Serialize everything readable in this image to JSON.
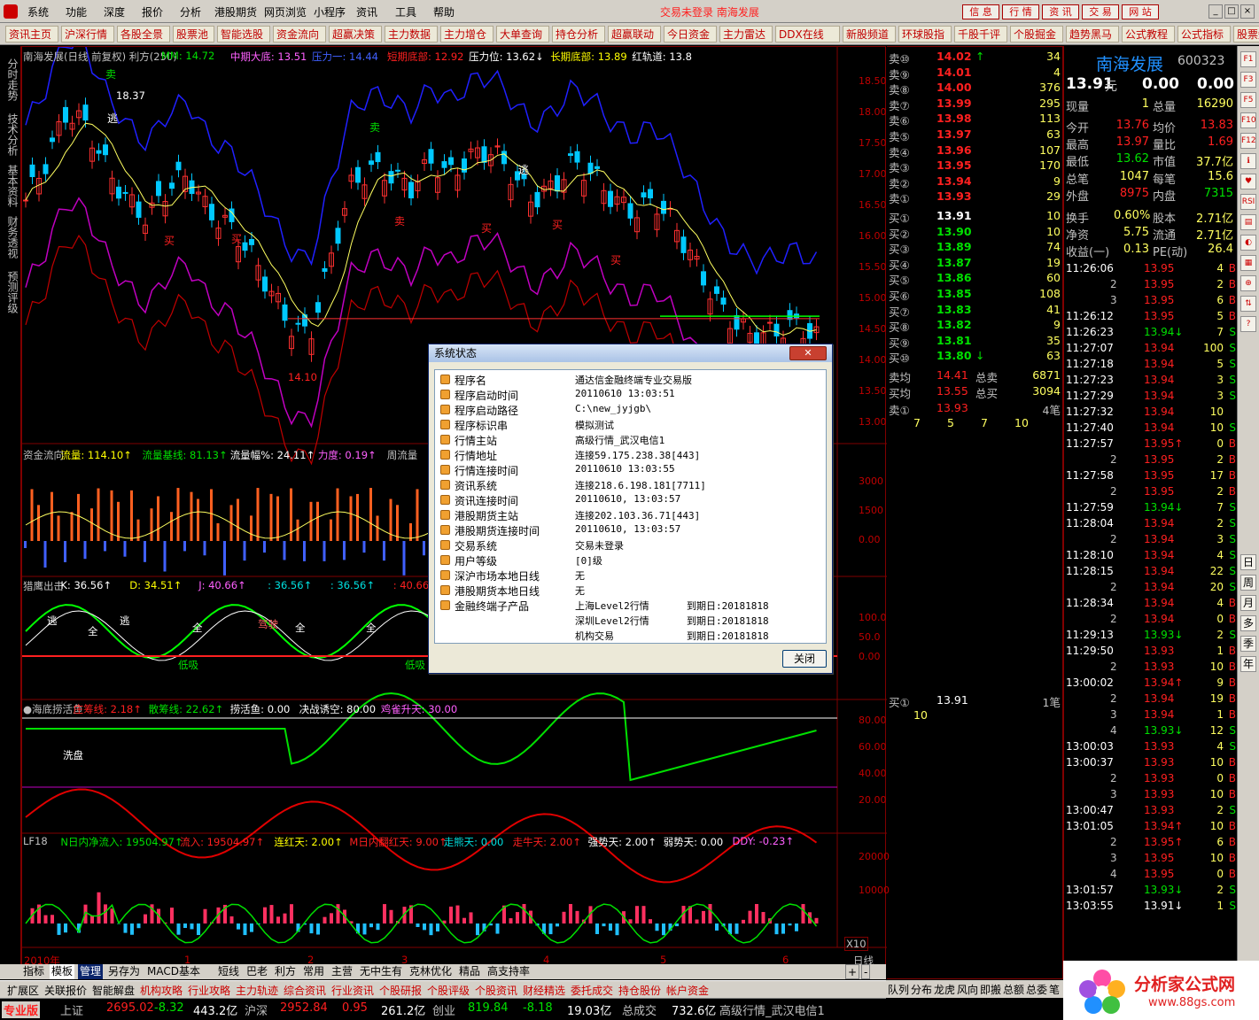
{
  "menu": [
    "系统",
    "功能",
    "深度",
    "报价",
    "分析",
    "港股期货",
    "网页浏览",
    "小程序",
    "资讯",
    "工具",
    "帮助"
  ],
  "trade_message": "交易未登录  南海发展",
  "right_buttons": [
    "信 息",
    "行 情",
    "资 讯",
    "交 易",
    "网 站"
  ],
  "toolbar": [
    "资讯主页",
    "沪深行情",
    "各股全景",
    "股票池",
    "智能选股",
    "资金流向",
    "超赢决策",
    "主力数据",
    "主力增仓",
    "大单查询",
    "持仓分析",
    "超赢联动",
    "今日资金",
    "主力雷达",
    "DDX在线",
    "新股频道",
    "环球股指",
    "千股千评",
    "个股掘金",
    "趋势黑马",
    "公式教程",
    "公式指标",
    "股票知识"
  ],
  "left_tabs": [
    "分时走势",
    "技术分析",
    "基本资料",
    "财务透视",
    "预测评级"
  ],
  "chart": {
    "title_row": [
      {
        "t": "南海发展(日线 前复权) 利方(250)",
        "c": "#c0c0c0"
      },
      {
        "t": "MM: 14.72",
        "c": "#00e000"
      },
      {
        "t": "中期大底: 13.51",
        "c": "#ff60ff"
      },
      {
        "t": "压力一: 14.44",
        "c": "#4060ff"
      },
      {
        "t": "短期底部: 12.92",
        "c": "#ff2020"
      },
      {
        "t": "压力位: 13.62↓",
        "c": "#ffffff"
      },
      {
        "t": "长期底部: 13.89",
        "c": "#ffff00"
      },
      {
        "t": "红轨道: 13.8",
        "c": "#ffffff"
      }
    ],
    "price_axis": [
      "18.50",
      "18.00",
      "17.50",
      "17.00",
      "16.50",
      "16.00",
      "15.50",
      "15.00",
      "14.50",
      "14.00",
      "13.50",
      "13.00"
    ],
    "label_peak": "18.37",
    "label_low": "14.10",
    "signals": [
      "卖",
      "卖",
      "逃",
      "买",
      "买",
      "卖",
      "买",
      "买",
      "买",
      "逃"
    ],
    "fund_row": [
      {
        "t": "资金流向",
        "c": "#c0c0c0"
      },
      {
        "t": "流量: 114.10↑",
        "c": "#ffff00"
      },
      {
        "t": "流量基线: 81.13↑",
        "c": "#00e000"
      },
      {
        "t": "流量幅%: 24.11↑",
        "c": "#ffffff"
      },
      {
        "t": "力度: 0.19↑",
        "c": "#ff60ff"
      },
      {
        "t": "周流量",
        "c": "#c0c0c0"
      }
    ],
    "fund_axis": [
      "3000",
      "1500",
      "0.00"
    ],
    "kdj_row": [
      {
        "t": "猎鹰出击",
        "c": "#c0c0c0"
      },
      {
        "t": "K: 36.56↑",
        "c": "#ffffff"
      },
      {
        "t": "D: 34.51↑",
        "c": "#ffff00"
      },
      {
        "t": "J: 40.66↑",
        "c": "#ff60ff"
      },
      {
        "t": ": 36.56↑",
        "c": "#00e0e0"
      },
      {
        "t": ": 36.56↑",
        "c": "#00e0e0"
      },
      {
        "t": ": 40.66↑",
        "c": "#ff2020"
      },
      {
        "t": ": 40.66↑",
        "c": "#00e000"
      }
    ],
    "kdj_axis": [
      "100.0",
      "50.0",
      "0.00"
    ],
    "kdj_labels": [
      "逃",
      "逃",
      "全",
      "低吸",
      "全",
      "驾驶",
      "全",
      "全",
      "低吸"
    ],
    "fish_row": [
      {
        "t": "●海底捞活鱼",
        "c": "#c0c0c0"
      },
      {
        "t": "庄筹线: 2.18↑",
        "c": "#ff2020"
      },
      {
        "t": "散筹线: 22.62↑",
        "c": "#00e000"
      },
      {
        "t": "捞活鱼: 0.00",
        "c": "#ffffff"
      },
      {
        "t": "决战诱空: 80.00",
        "c": "#ffffff"
      },
      {
        "t": "鸡雀升天: 30.00",
        "c": "#ff60ff"
      }
    ],
    "fish_axis": [
      "80.00",
      "60.00",
      "40.00",
      "20.00"
    ],
    "fish_label": "洗盘",
    "lf_row": [
      {
        "t": "LF18",
        "c": "#c0c0c0"
      },
      {
        "t": "N日内净流入: 19504.97↑",
        "c": "#00e000"
      },
      {
        "t": "流入: 19504.97↑",
        "c": "#ff2020"
      },
      {
        "t": "连红天: 2.00↑",
        "c": "#ffff00"
      },
      {
        "t": "M日内翻红天: 9.00↑",
        "c": "#ff2020"
      },
      {
        "t": "走熊天: 0.00",
        "c": "#00e0e0"
      },
      {
        "t": "走牛天: 2.00↑",
        "c": "#ff2020"
      },
      {
        "t": "强势天: 2.00↑",
        "c": "#ffffff"
      },
      {
        "t": "弱势天: 0.00",
        "c": "#ffffff"
      },
      {
        "t": "DDY: -0.23↑",
        "c": "#ff60ff"
      }
    ],
    "lf_axis": [
      "20000",
      "10000"
    ],
    "x10": "X10",
    "time_axis": [
      "2010年",
      "1",
      "2",
      "3",
      "4",
      "5",
      "6"
    ],
    "period": "日线"
  },
  "bottom_tabs": [
    "指标",
    "模板",
    "管理",
    "另存为",
    "MACD基本",
    "短线",
    "巴老",
    "利方",
    "常用",
    "主营",
    "无中生有",
    "克林优化",
    "精品",
    "高支持率"
  ],
  "bottom_links": [
    "扩展区",
    "关联报价",
    "智能解盘",
    "机构攻略",
    "行业攻略",
    "主力轨迹",
    "综合资讯",
    "行业资讯",
    "个股研报",
    "个股评级",
    "个股资讯",
    "财经精选",
    "委托成交",
    "持仓股份",
    "帐户资金"
  ],
  "status": [
    {
      "t": "专业版",
      "c": "#ff2020"
    },
    {
      "t": "上证",
      "c": "#c0c0c0"
    },
    {
      "t": "2695.02",
      "c": "#ff2020"
    },
    {
      "t": "-8.32",
      "c": "#00e000"
    },
    {
      "t": "443.2亿",
      "c": "#ffffff"
    },
    {
      "t": "沪深",
      "c": "#c0c0c0"
    },
    {
      "t": "2952.84",
      "c": "#ff2020"
    },
    {
      "t": "0.95",
      "c": "#ff2020"
    },
    {
      "t": "261.2亿",
      "c": "#ffffff"
    },
    {
      "t": "创业",
      "c": "#c0c0c0"
    },
    {
      "t": "819.84",
      "c": "#00e000"
    },
    {
      "t": "-8.18",
      "c": "#00e000"
    },
    {
      "t": "19.03亿",
      "c": "#ffffff"
    },
    {
      "t": "总成交",
      "c": "#c0c0c0"
    },
    {
      "t": "732.6亿",
      "c": "#ffffff"
    },
    {
      "t": "高级行情_武汉电信1",
      "c": "#c0c0c0"
    }
  ],
  "orderbook": {
    "sells": [
      {
        "l": "卖⑩",
        "p": "14.02",
        "v": "34",
        "a": "↑"
      },
      {
        "l": "卖⑨",
        "p": "14.01",
        "v": "4",
        "a": ""
      },
      {
        "l": "卖⑧",
        "p": "14.00",
        "v": "376",
        "a": ""
      },
      {
        "l": "卖⑦",
        "p": "13.99",
        "v": "295",
        "a": ""
      },
      {
        "l": "卖⑥",
        "p": "13.98",
        "v": "113",
        "a": ""
      },
      {
        "l": "卖⑤",
        "p": "13.97",
        "v": "63",
        "a": ""
      },
      {
        "l": "卖④",
        "p": "13.96",
        "v": "107",
        "a": ""
      },
      {
        "l": "卖③",
        "p": "13.95",
        "v": "170",
        "a": ""
      },
      {
        "l": "卖②",
        "p": "13.94",
        "v": "9",
        "a": ""
      },
      {
        "l": "卖①",
        "p": "13.93",
        "v": "29",
        "a": ""
      }
    ],
    "buys": [
      {
        "l": "买①",
        "p": "13.91",
        "v": "10",
        "a": ""
      },
      {
        "l": "买②",
        "p": "13.90",
        "v": "10",
        "a": ""
      },
      {
        "l": "买③",
        "p": "13.89",
        "v": "74",
        "a": ""
      },
      {
        "l": "买④",
        "p": "13.87",
        "v": "19",
        "a": ""
      },
      {
        "l": "买⑤",
        "p": "13.86",
        "v": "60",
        "a": ""
      },
      {
        "l": "买⑥",
        "p": "13.85",
        "v": "108",
        "a": ""
      },
      {
        "l": "买⑦",
        "p": "13.83",
        "v": "41",
        "a": ""
      },
      {
        "l": "买⑧",
        "p": "13.82",
        "v": "9",
        "a": ""
      },
      {
        "l": "买⑨",
        "p": "13.81",
        "v": "35",
        "a": ""
      },
      {
        "l": "买⑩",
        "p": "13.80",
        "v": "63",
        "a": "↓"
      }
    ],
    "avg_sell": {
      "l": "卖均",
      "p": "14.41",
      "k": "总卖",
      "v": "6871"
    },
    "avg_buy": {
      "l": "买均",
      "p": "13.55",
      "k": "总买",
      "v": "3094"
    },
    "sell1_detail": {
      "l": "卖①",
      "p": "13.93",
      "v": "4笔",
      "q": [
        "7",
        "5",
        "7",
        "10"
      ]
    },
    "buy1_detail": {
      "l": "买①",
      "p": "13.91",
      "v": "1笔",
      "q": [
        "10"
      ]
    }
  },
  "quote": {
    "name": "南海发展",
    "code": "600323",
    "price": "13.91",
    "unit": "元",
    "change": "0.00",
    "pct": "0.00",
    "rows": [
      [
        "现量",
        "1",
        "总量",
        "16290"
      ],
      [
        "今开",
        "13.76",
        "均价",
        "13.83"
      ],
      [
        "最高",
        "13.97",
        "量比",
        "1.69"
      ],
      [
        "最低",
        "13.62",
        "市值",
        "37.7亿"
      ],
      [
        "总笔",
        "1047",
        "每笔",
        "15.6"
      ],
      [
        "外盘",
        "8975",
        "内盘",
        "7315"
      ],
      [
        "换手",
        "0.60%",
        "股本",
        "2.71亿"
      ],
      [
        "净资",
        "5.75",
        "流通",
        "2.71亿"
      ],
      [
        "收益(一)",
        "0.13",
        "PE(动)",
        "26.4"
      ]
    ]
  },
  "ticks": [
    [
      "11:26:06",
      "13.95",
      "4",
      "B"
    ],
    [
      "2",
      "13.95",
      "2",
      "B"
    ],
    [
      "3",
      "13.95",
      "6",
      "B"
    ],
    [
      "11:26:12",
      "13.95",
      "5",
      "B"
    ],
    [
      "11:26:23",
      "13.94↓",
      "7",
      "S"
    ],
    [
      "11:27:07",
      "13.94",
      "100",
      "S"
    ],
    [
      "11:27:18",
      "13.94",
      "5",
      "S"
    ],
    [
      "11:27:23",
      "13.94",
      "3",
      "S"
    ],
    [
      "11:27:29",
      "13.94",
      "3",
      "S"
    ],
    [
      "11:27:32",
      "13.94",
      "10",
      ""
    ],
    [
      "11:27:40",
      "13.94",
      "10",
      "S"
    ],
    [
      "11:27:57",
      "13.95↑",
      "0",
      "B"
    ],
    [
      "2",
      "13.95",
      "2",
      "B"
    ],
    [
      "11:27:58",
      "13.95",
      "17",
      "B"
    ],
    [
      "2",
      "13.95",
      "2",
      "B"
    ],
    [
      "11:27:59",
      "13.94↓",
      "7",
      "S"
    ],
    [
      "11:28:04",
      "13.94",
      "2",
      "S"
    ],
    [
      "2",
      "13.94",
      "3",
      "S"
    ],
    [
      "11:28:10",
      "13.94",
      "4",
      "S"
    ],
    [
      "11:28:15",
      "13.94",
      "22",
      "S"
    ],
    [
      "2",
      "13.94",
      "20",
      "S"
    ],
    [
      "11:28:34",
      "13.94",
      "4",
      "B"
    ],
    [
      "2",
      "13.94",
      "0",
      "B"
    ],
    [
      "11:29:13",
      "13.93↓",
      "2",
      "S"
    ],
    [
      "11:29:50",
      "13.93",
      "1",
      "B"
    ],
    [
      "2",
      "13.93",
      "10",
      "B"
    ],
    [
      "13:00:02",
      "13.94↑",
      "9",
      "B"
    ],
    [
      "2",
      "13.94",
      "19",
      "B"
    ],
    [
      "3",
      "13.94",
      "1",
      "B"
    ],
    [
      "4",
      "13.93↓",
      "12",
      "S"
    ],
    [
      "13:00:03",
      "13.93",
      "4",
      "S"
    ],
    [
      "13:00:37",
      "13.93",
      "10",
      "B"
    ],
    [
      "2",
      "13.93",
      "0",
      "B"
    ],
    [
      "3",
      "13.93",
      "10",
      "B"
    ],
    [
      "13:00:47",
      "13.93",
      "2",
      "S"
    ],
    [
      "13:01:05",
      "13.94↑",
      "10",
      "B"
    ],
    [
      "2",
      "13.95↑",
      "6",
      "B"
    ],
    [
      "3",
      "13.95",
      "10",
      "B"
    ],
    [
      "4",
      "13.95",
      "0",
      "B"
    ],
    [
      "13:01:57",
      "13.93↓",
      "2",
      "S"
    ],
    [
      "13:03:55",
      "13.91↓",
      "1",
      "S"
    ]
  ],
  "right_icons": [
    "F1",
    "F3",
    "F5",
    "F10",
    "F12",
    "ℹ",
    "♥",
    "RSI",
    "▤",
    "◐",
    "▦",
    "⊕",
    "⇅",
    "?"
  ],
  "period_tabs": [
    "日",
    "周",
    "月",
    "多",
    "季",
    "年"
  ],
  "quote_tabs": [
    "队列",
    "分布",
    "龙虎",
    "风向",
    "即搬",
    "总额",
    "总委",
    "笔"
  ],
  "logo_text": "分析家公式网",
  "logo_url": "www.88gs.com",
  "dialog": {
    "title": "系统状态",
    "close_label": "关闭",
    "rows": [
      [
        "程序名",
        "通达信金融终端专业交易版",
        ""
      ],
      [
        "程序启动时间",
        "20110610  13:03:51",
        ""
      ],
      [
        "程序启动路径",
        "C:\\new_jyjgb\\",
        ""
      ],
      [
        "程序标识串",
        "模拟测试",
        ""
      ],
      [
        "行情主站",
        "高级行情_武汉电信1",
        ""
      ],
      [
        "行情地址",
        "连接59.175.238.38[443]",
        ""
      ],
      [
        "行情连接时间",
        "20110610  13:03:55",
        ""
      ],
      [
        "资讯系统",
        "连接218.6.198.181[7711]",
        ""
      ],
      [
        "资讯连接时间",
        "20110610, 13:03:57",
        ""
      ],
      [
        "港股期货主站",
        "连接202.103.36.71[443]",
        ""
      ],
      [
        "港股期货连接时间",
        "20110610, 13:03:57",
        ""
      ],
      [
        "交易系统",
        "交易未登录",
        ""
      ],
      [
        "用户等级",
        "[0]级",
        ""
      ],
      [
        "深沪市场本地日线",
        "无",
        ""
      ],
      [
        "港股期货本地日线",
        "无",
        ""
      ],
      [
        "金融终端子产品",
        "上海Level2行情",
        "到期日:20181818"
      ],
      [
        "",
        "深圳Level2行情",
        "到期日:20181818"
      ],
      [
        "",
        "机构交易",
        "到期日:20181818"
      ]
    ]
  },
  "colors": {
    "up": "#ff2020",
    "down": "#00e000",
    "bg": "#000000",
    "frame": "#800000"
  }
}
